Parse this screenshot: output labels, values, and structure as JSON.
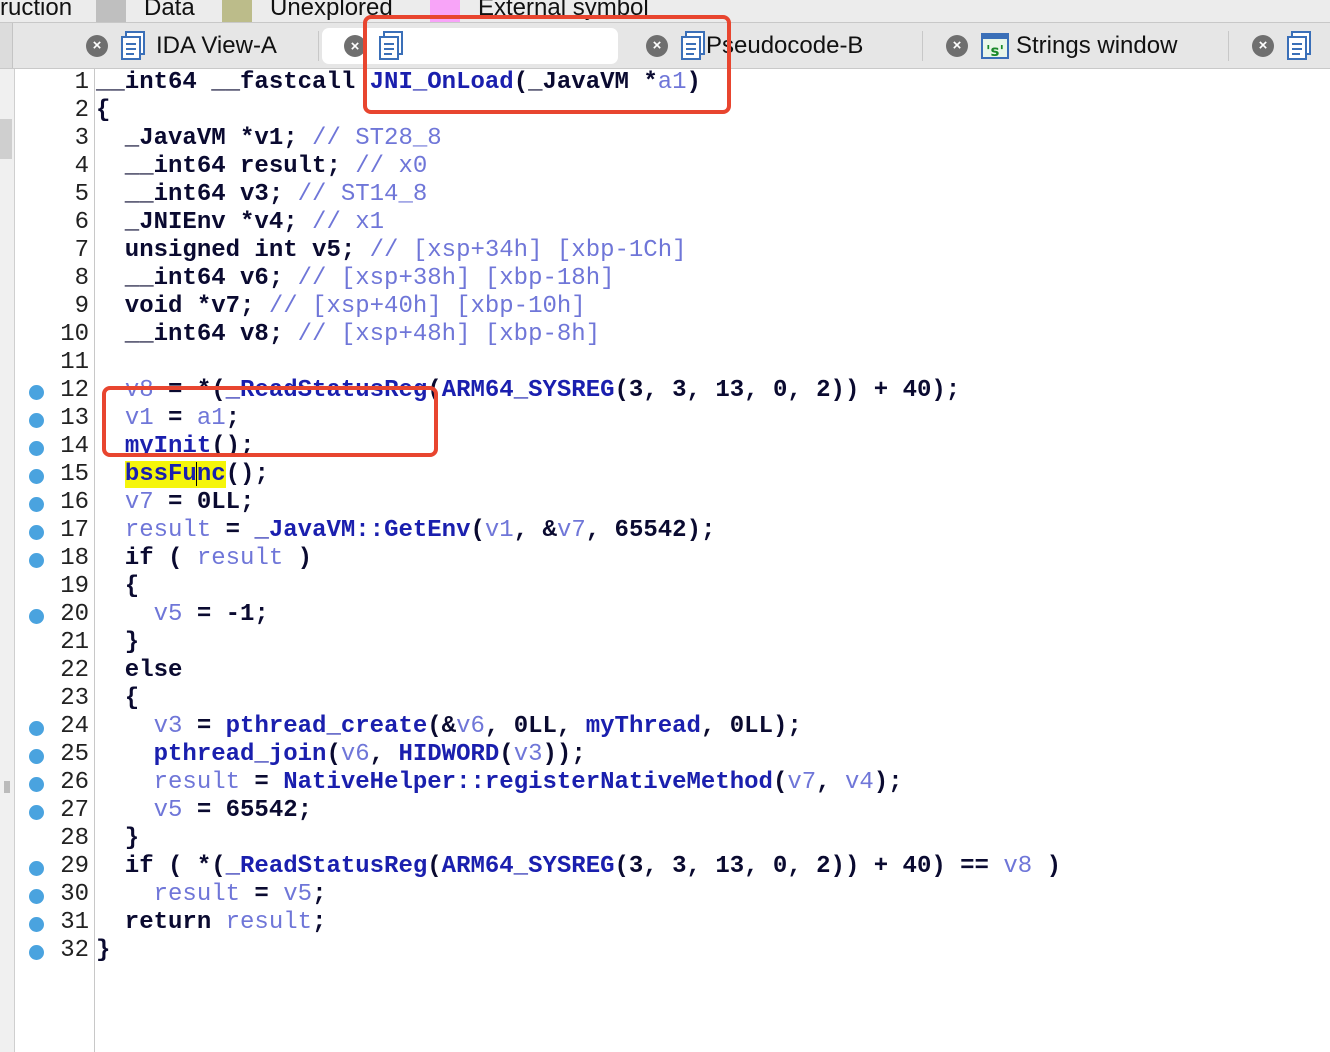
{
  "legend": [
    "ruction",
    "Data",
    "Unexplored",
    "External symbol"
  ],
  "legend_colors": {
    "instruction": "#bfbfbf",
    "data": "#bcbc8a",
    "unexplored": "#c0c07a",
    "external": "#f8a4f8"
  },
  "tabs": [
    {
      "label": "IDA View-A",
      "icon": "document-icon",
      "close": "×"
    },
    {
      "label": "",
      "icon": "document-icon",
      "close": "×"
    },
    {
      "label": "Pseudocode-B",
      "icon": "document-icon",
      "close": "×"
    },
    {
      "label": "Strings window",
      "icon": "strings-icon",
      "close": "×"
    },
    {
      "label": "",
      "icon": "document-icon",
      "close": "×"
    }
  ],
  "colors": {
    "keyword": "#0a0a30",
    "variable": "#6f76d8",
    "function": "#1a1fae",
    "highlight": "#f5f50a",
    "annotation": "#e8452f",
    "breakpoint_dot": "#4aa3df"
  },
  "code": [
    {
      "n": "1",
      "bp": false,
      "segs": [
        [
          "kw",
          "__int64 __fastcall "
        ],
        [
          "fn",
          "JNI_OnLoad"
        ],
        [
          "pl",
          "("
        ],
        [
          "kw",
          "_JavaVM"
        ],
        [
          "pl",
          " *"
        ],
        [
          "var",
          "a1"
        ],
        [
          "pl",
          ")"
        ]
      ]
    },
    {
      "n": "2",
      "bp": false,
      "segs": [
        [
          "pl",
          "{"
        ]
      ]
    },
    {
      "n": "3",
      "bp": false,
      "segs": [
        [
          "pl",
          "  _JavaVM *v1; "
        ],
        [
          "cm",
          "// ST28_8"
        ]
      ]
    },
    {
      "n": "4",
      "bp": false,
      "segs": [
        [
          "pl",
          "  __int64 result; "
        ],
        [
          "cm",
          "// x0"
        ]
      ]
    },
    {
      "n": "5",
      "bp": false,
      "segs": [
        [
          "pl",
          "  __int64 v3; "
        ],
        [
          "cm",
          "// ST14_8"
        ]
      ]
    },
    {
      "n": "6",
      "bp": false,
      "segs": [
        [
          "pl",
          "  _JNIEnv *v4; "
        ],
        [
          "cm",
          "// x1"
        ]
      ]
    },
    {
      "n": "7",
      "bp": false,
      "segs": [
        [
          "pl",
          "  unsigned int v5; "
        ],
        [
          "cm",
          "// [xsp+34h] [xbp-1Ch]"
        ]
      ]
    },
    {
      "n": "8",
      "bp": false,
      "segs": [
        [
          "pl",
          "  __int64 v6; "
        ],
        [
          "cm",
          "// [xsp+38h] [xbp-18h]"
        ]
      ]
    },
    {
      "n": "9",
      "bp": false,
      "segs": [
        [
          "pl",
          "  void *v7; "
        ],
        [
          "cm",
          "// [xsp+40h] [xbp-10h]"
        ]
      ]
    },
    {
      "n": "10",
      "bp": false,
      "segs": [
        [
          "pl",
          "  __int64 v8; "
        ],
        [
          "cm",
          "// [xsp+48h] [xbp-8h]"
        ]
      ]
    },
    {
      "n": "11",
      "bp": false,
      "segs": [
        [
          "pl",
          ""
        ]
      ]
    },
    {
      "n": "12",
      "bp": true,
      "segs": [
        [
          "pl",
          "  "
        ],
        [
          "var",
          "v8"
        ],
        [
          "pl",
          " = *("
        ],
        [
          "fn",
          "_ReadStatusReg"
        ],
        [
          "pl",
          "("
        ],
        [
          "fn",
          "ARM64_SYSREG"
        ],
        [
          "pl",
          "(3, 3, 13, 0, 2)) + 40);"
        ]
      ]
    },
    {
      "n": "13",
      "bp": true,
      "segs": [
        [
          "pl",
          "  "
        ],
        [
          "var",
          "v1"
        ],
        [
          "pl",
          " = "
        ],
        [
          "var",
          "a1"
        ],
        [
          "pl",
          ";"
        ]
      ]
    },
    {
      "n": "14",
      "bp": true,
      "segs": [
        [
          "pl",
          "  "
        ],
        [
          "fn",
          "myInit"
        ],
        [
          "pl",
          "();"
        ]
      ]
    },
    {
      "n": "15",
      "bp": true,
      "segs": [
        [
          "pl",
          "  "
        ],
        [
          "hl",
          "bssFu"
        ],
        [
          "cursor",
          ""
        ],
        [
          "hl",
          "nc"
        ],
        [
          "pl",
          "();"
        ]
      ]
    },
    {
      "n": "16",
      "bp": true,
      "segs": [
        [
          "pl",
          "  "
        ],
        [
          "var",
          "v7"
        ],
        [
          "pl",
          " = 0LL;"
        ]
      ]
    },
    {
      "n": "17",
      "bp": true,
      "segs": [
        [
          "pl",
          "  "
        ],
        [
          "var",
          "result"
        ],
        [
          "pl",
          " = "
        ],
        [
          "fn",
          "_JavaVM::GetEnv"
        ],
        [
          "pl",
          "("
        ],
        [
          "var",
          "v1"
        ],
        [
          "pl",
          ", &"
        ],
        [
          "var",
          "v7"
        ],
        [
          "pl",
          ", 65542);"
        ]
      ]
    },
    {
      "n": "18",
      "bp": true,
      "segs": [
        [
          "pl",
          "  if ( "
        ],
        [
          "var",
          "result"
        ],
        [
          "pl",
          " )"
        ]
      ]
    },
    {
      "n": "19",
      "bp": false,
      "segs": [
        [
          "pl",
          "  {"
        ]
      ]
    },
    {
      "n": "20",
      "bp": true,
      "segs": [
        [
          "pl",
          "    "
        ],
        [
          "var",
          "v5"
        ],
        [
          "pl",
          " = -1;"
        ]
      ]
    },
    {
      "n": "21",
      "bp": false,
      "segs": [
        [
          "pl",
          "  }"
        ]
      ]
    },
    {
      "n": "22",
      "bp": false,
      "segs": [
        [
          "pl",
          "  else"
        ]
      ]
    },
    {
      "n": "23",
      "bp": false,
      "segs": [
        [
          "pl",
          "  {"
        ]
      ]
    },
    {
      "n": "24",
      "bp": true,
      "segs": [
        [
          "pl",
          "    "
        ],
        [
          "var",
          "v3"
        ],
        [
          "pl",
          " = "
        ],
        [
          "fn",
          "pthread_create"
        ],
        [
          "pl",
          "(&"
        ],
        [
          "var",
          "v6"
        ],
        [
          "pl",
          ", 0LL, "
        ],
        [
          "fn",
          "myThread"
        ],
        [
          "pl",
          ", 0LL);"
        ]
      ]
    },
    {
      "n": "25",
      "bp": true,
      "segs": [
        [
          "pl",
          "    "
        ],
        [
          "fn",
          "pthread_join"
        ],
        [
          "pl",
          "("
        ],
        [
          "var",
          "v6"
        ],
        [
          "pl",
          ", "
        ],
        [
          "fn",
          "HIDWORD"
        ],
        [
          "pl",
          "("
        ],
        [
          "var",
          "v3"
        ],
        [
          "pl",
          "));"
        ]
      ]
    },
    {
      "n": "26",
      "bp": true,
      "segs": [
        [
          "pl",
          "    "
        ],
        [
          "var",
          "result"
        ],
        [
          "pl",
          " = "
        ],
        [
          "fn",
          "NativeHelper::registerNativeMethod"
        ],
        [
          "pl",
          "("
        ],
        [
          "var",
          "v7"
        ],
        [
          "pl",
          ", "
        ],
        [
          "var",
          "v4"
        ],
        [
          "pl",
          ");"
        ]
      ]
    },
    {
      "n": "27",
      "bp": true,
      "segs": [
        [
          "pl",
          "    "
        ],
        [
          "var",
          "v5"
        ],
        [
          "pl",
          " = 65542;"
        ]
      ]
    },
    {
      "n": "28",
      "bp": false,
      "segs": [
        [
          "pl",
          "  }"
        ]
      ]
    },
    {
      "n": "29",
      "bp": true,
      "segs": [
        [
          "pl",
          "  if ( *("
        ],
        [
          "fn",
          "_ReadStatusReg"
        ],
        [
          "pl",
          "("
        ],
        [
          "fn",
          "ARM64_SYSREG"
        ],
        [
          "pl",
          "(3, 3, 13, 0, 2)) + 40) == "
        ],
        [
          "var",
          "v8"
        ],
        [
          "pl",
          " )"
        ]
      ]
    },
    {
      "n": "30",
      "bp": true,
      "segs": [
        [
          "pl",
          "    "
        ],
        [
          "var",
          "result"
        ],
        [
          "pl",
          " = "
        ],
        [
          "var",
          "v5"
        ],
        [
          "pl",
          ";"
        ]
      ]
    },
    {
      "n": "31",
      "bp": true,
      "segs": [
        [
          "pl",
          "  return "
        ],
        [
          "var",
          "result"
        ],
        [
          "pl",
          ";"
        ]
      ]
    },
    {
      "n": "32",
      "bp": true,
      "segs": [
        [
          "pl",
          "}"
        ]
      ]
    }
  ]
}
